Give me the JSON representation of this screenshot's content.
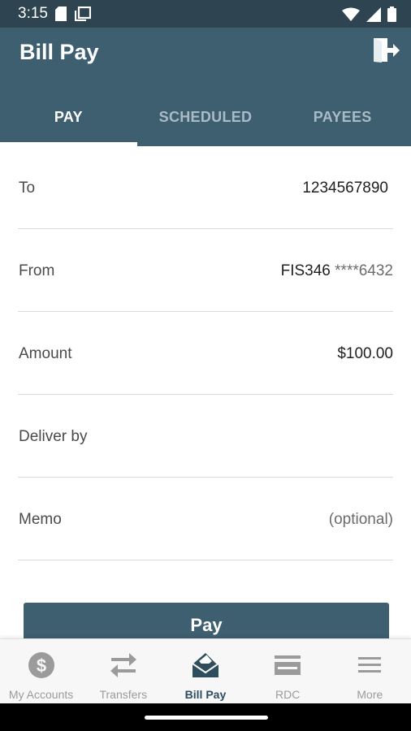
{
  "status_bar": {
    "time": "3:15"
  },
  "header": {
    "title": "Bill Pay",
    "logout_icon": "logout-icon"
  },
  "tabs": [
    {
      "label": "PAY",
      "active": true
    },
    {
      "label": "SCHEDULED",
      "active": false
    },
    {
      "label": "PAYEES",
      "active": false
    }
  ],
  "form": {
    "to": {
      "label": "To",
      "value": "1234567890"
    },
    "from": {
      "label": "From",
      "account_name": "FIS346",
      "account_mask": "****6432"
    },
    "amount": {
      "label": "Amount",
      "value": "$100.00"
    },
    "deliver_by": {
      "label": "Deliver by",
      "value": ""
    },
    "memo": {
      "label": "Memo",
      "placeholder": "(optional)"
    }
  },
  "pay_button": {
    "label": "Pay"
  },
  "bottom_nav": [
    {
      "label": "My Accounts",
      "icon": "dollar-icon",
      "active": false
    },
    {
      "label": "Transfers",
      "icon": "transfer-arrows-icon",
      "active": false
    },
    {
      "label": "Bill Pay",
      "icon": "bill-pay-icon",
      "active": true
    },
    {
      "label": "RDC",
      "icon": "check-deposit-icon",
      "active": false
    },
    {
      "label": "More",
      "icon": "menu-icon",
      "active": false
    }
  ],
  "colors": {
    "header": "#3e5f70",
    "status_bar": "#2e4451",
    "accent": "#2e4e5e"
  }
}
